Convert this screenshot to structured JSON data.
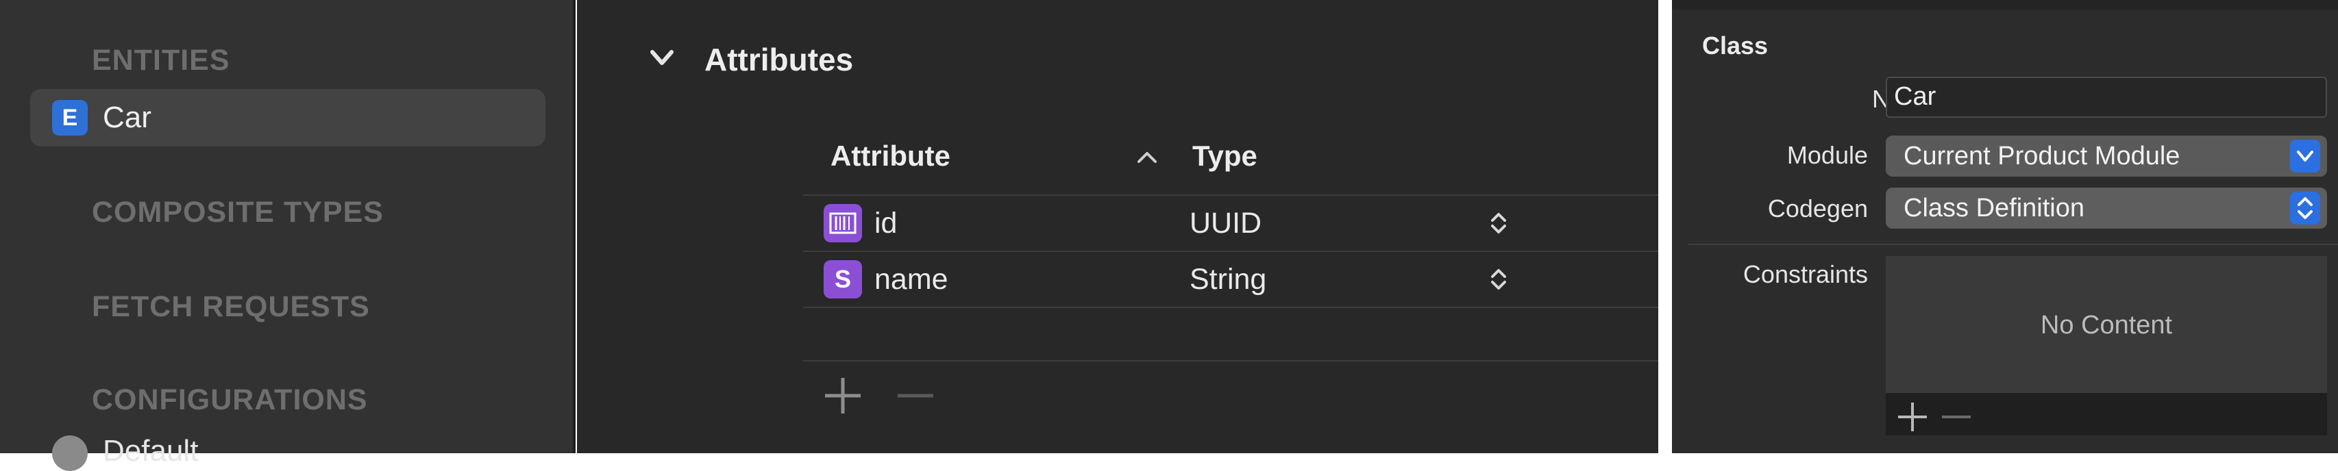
{
  "sidebar": {
    "entities_heading": "ENTITIES",
    "entity": {
      "badge": "E",
      "label": "Car"
    },
    "composite_heading": "COMPOSITE TYPES",
    "fetch_heading": "FETCH REQUESTS",
    "configurations_heading": "CONFIGURATIONS",
    "configuration_item": "Default"
  },
  "main": {
    "section_title": "Attributes",
    "columns": {
      "attribute": "Attribute",
      "type": "Type"
    },
    "rows": [
      {
        "badge": "",
        "name": "id",
        "type": "UUID"
      },
      {
        "badge": "S",
        "name": "name",
        "type": "String"
      }
    ]
  },
  "inspector": {
    "heading": "Class",
    "name_label": "Name",
    "name_value": "Car",
    "module_label": "Module",
    "module_value": "Current Product Module",
    "codegen_label": "Codegen",
    "codegen_value": "Class Definition",
    "constraints_label": "Constraints",
    "constraints_empty": "No Content"
  },
  "colors": {
    "entity_badge": "#2f70d6",
    "attribute_badge": "#8b4fd6",
    "popup_accent": "#2b6fe0"
  }
}
